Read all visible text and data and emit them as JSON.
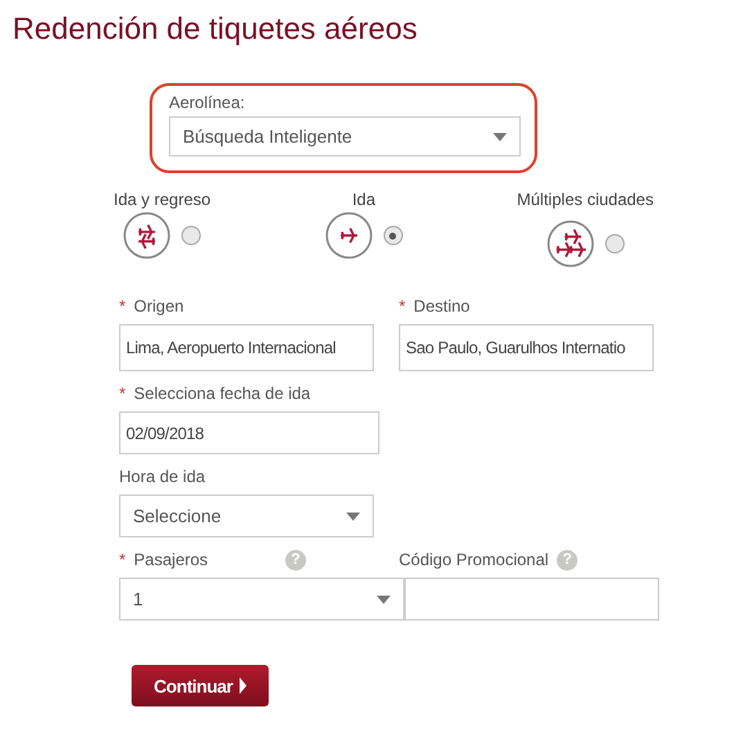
{
  "title": "Redención de tiquetes aéreos",
  "airline": {
    "label": "Aerolínea:",
    "value": "Búsqueda Inteligente"
  },
  "trip_types": [
    {
      "label": "Ida y regreso",
      "kind": "roundtrip",
      "selected": false
    },
    {
      "label": "Ida",
      "kind": "oneway",
      "selected": true
    },
    {
      "label": "Múltiples ciudades",
      "kind": "multicity",
      "selected": false
    }
  ],
  "origin": {
    "marker": "*",
    "label": "Origen",
    "value": "Lima, Aeropuerto Internacional"
  },
  "destination": {
    "marker": "*",
    "label": "Destino",
    "value": "Sao Paulo, Guarulhos Internatio"
  },
  "date": {
    "marker": "*",
    "label": "Selecciona fecha de ida",
    "value": "02/09/2018"
  },
  "time": {
    "label": "Hora de ida",
    "value": "Seleccione"
  },
  "passengers": {
    "marker": "*",
    "label": "Pasajeros",
    "help": "?",
    "value": "1"
  },
  "promo": {
    "label": "Código Promocional",
    "help": "?"
  },
  "submit": {
    "label": "Continuar"
  }
}
